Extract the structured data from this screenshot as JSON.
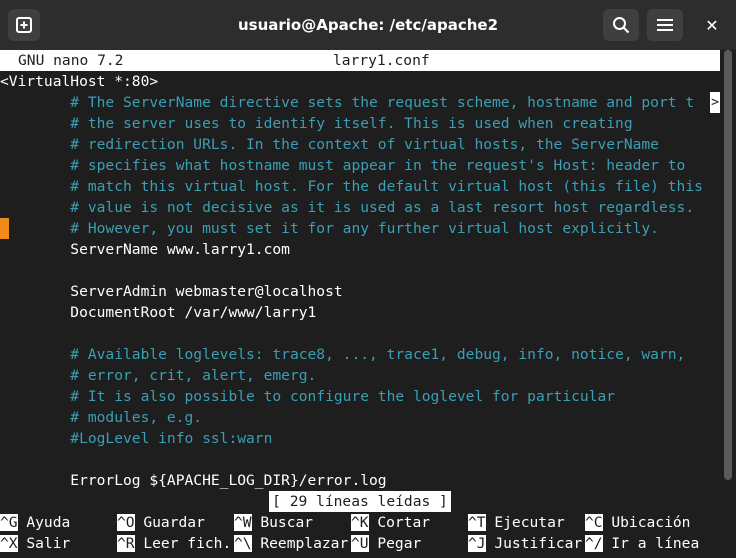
{
  "window": {
    "title": "usuario@Apache: /etc/apache2",
    "new_tab_icon": "new-tab-icon",
    "search_icon": "search-icon",
    "menu_icon": "hamburger-menu-icon",
    "close_glyph": "✕"
  },
  "editor": {
    "app": "GNU nano 7.2",
    "filename": "larry1.conf",
    "scroll_indicator": ">",
    "status": "[ 29 líneas leídas ]"
  },
  "content": {
    "l1": "<VirtualHost *:80>",
    "l2": "        # The ServerName directive sets the request scheme, hostname and port t",
    "l3": "        # the server uses to identify itself. This is used when creating",
    "l4": "        # redirection URLs. In the context of virtual hosts, the ServerName",
    "l5": "        # specifies what hostname must appear in the request's Host: header to",
    "l6": "        # match this virtual host. For the default virtual host (this file) this",
    "l7": "        # value is not decisive as it is used as a last resort host regardless.",
    "l8": "        # However, you must set it for any further virtual host explicitly.",
    "l9": "        ServerName www.larry1.com",
    "l10": "",
    "l11": "        ServerAdmin webmaster@localhost",
    "l12": "        DocumentRoot /var/www/larry1",
    "l13": "",
    "l14": "        # Available loglevels: trace8, ..., trace1, debug, info, notice, warn,",
    "l15": "        # error, crit, alert, emerg.",
    "l16": "        # It is also possible to configure the loglevel for particular",
    "l17": "        # modules, e.g.",
    "l18": "        #LogLevel info ssl:warn",
    "l19": "",
    "l20": "        ErrorLog ${APACHE_LOG_DIR}/error.log"
  },
  "shortcuts": {
    "row1": [
      {
        "key": "^G",
        "label": " Ayuda"
      },
      {
        "key": "^O",
        "label": " Guardar"
      },
      {
        "key": "^W",
        "label": " Buscar"
      },
      {
        "key": "^K",
        "label": " Cortar"
      },
      {
        "key": "^T",
        "label": " Ejecutar"
      },
      {
        "key": "^C",
        "label": " Ubicación"
      }
    ],
    "row2": [
      {
        "key": "^X",
        "label": " Salir"
      },
      {
        "key": "^R",
        "label": " Leer fich."
      },
      {
        "key": "^\\",
        "label": " Reemplazar"
      },
      {
        "key": "^U",
        "label": " Pegar"
      },
      {
        "key": "^J",
        "label": " Justificar"
      },
      {
        "key": "^/",
        "label": " Ir a línea"
      }
    ]
  },
  "colors": {
    "comment": "#3a9fb5",
    "marker": "#f08a1b",
    "background": "#1e1e1e"
  }
}
